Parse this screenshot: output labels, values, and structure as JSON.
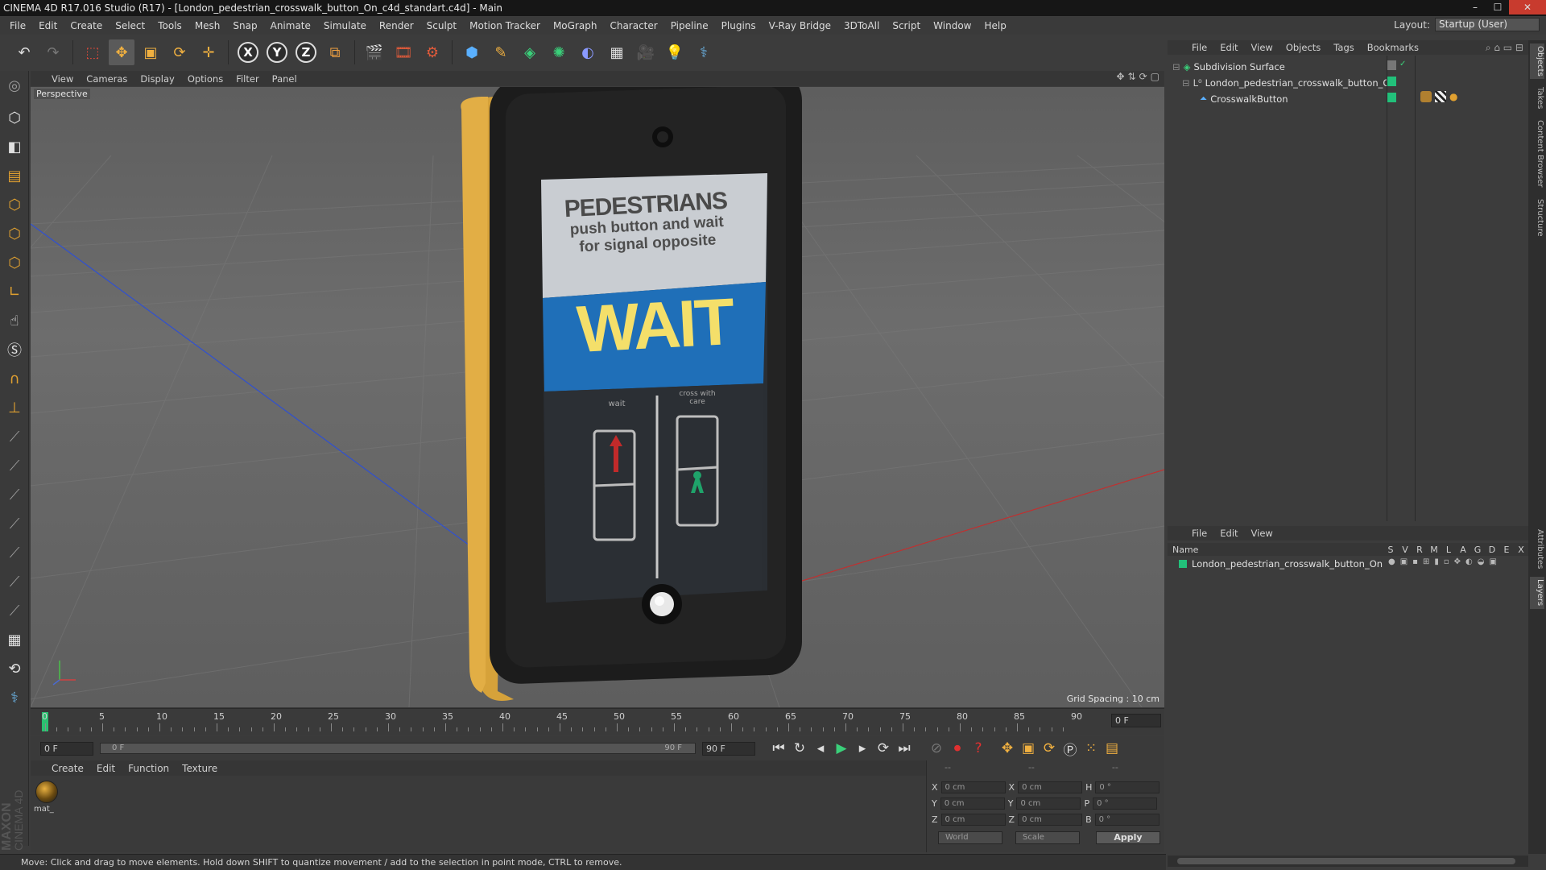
{
  "window": {
    "title": "CINEMA 4D R17.016 Studio (R17) - [London_pedestrian_crosswalk_button_On_c4d_standart.c4d] - Main",
    "minimize": "–",
    "maximize": "☐",
    "close": "✕"
  },
  "menubar": [
    "File",
    "Edit",
    "Create",
    "Select",
    "Tools",
    "Mesh",
    "Snap",
    "Animate",
    "Simulate",
    "Render",
    "Sculpt",
    "Motion Tracker",
    "MoGraph",
    "Character",
    "Pipeline",
    "Plugins",
    "V-Ray Bridge",
    "3DToAll",
    "Script",
    "Window",
    "Help"
  ],
  "layout": {
    "label": "Layout:",
    "value": "Startup (User)"
  },
  "toolbar": {
    "axes": [
      "X",
      "Y",
      "Z"
    ],
    "icons": [
      "undo-icon",
      "redo-icon",
      "live-selection-icon",
      "move-icon",
      "scale-icon",
      "rotate-icon",
      "transform-icon",
      "x-axis-icon",
      "y-axis-icon",
      "z-axis-icon",
      "coordinate-system-icon",
      "render-view-icon",
      "render-to-picture-viewer-icon",
      "edit-render-settings-icon",
      "cube-icon",
      "pen-spline-icon",
      "subdivision-surface-icon",
      "array-icon",
      "deformer-icon",
      "floor-icon",
      "camera-icon",
      "light-icon",
      "python-icon"
    ]
  },
  "viewport": {
    "menu": [
      "View",
      "Cameras",
      "Display",
      "Options",
      "Filter",
      "Panel"
    ],
    "label": "Perspective",
    "grid_spacing": "Grid Spacing : 10 cm",
    "sign": {
      "top_line1": "PEDESTRIANS",
      "top_line2": "push button and wait",
      "top_line3": "for signal opposite",
      "wait": "WAIT",
      "small_left": "wait",
      "small_right": "cross with care"
    }
  },
  "timeline": {
    "ticks": [
      "0",
      "5",
      "10",
      "15",
      "20",
      "25",
      "30",
      "35",
      "40",
      "45",
      "50",
      "55",
      "60",
      "65",
      "70",
      "75",
      "80",
      "85",
      "90"
    ],
    "current_frame": "0 F",
    "start_frame": "0 F",
    "range_start": "0 F",
    "range_end": "90 F",
    "end_frame": "90 F"
  },
  "materials": {
    "menu": [
      "Create",
      "Edit",
      "Function",
      "Texture"
    ],
    "items": [
      {
        "label": "mat_"
      }
    ]
  },
  "coordinates": {
    "header": [
      "--",
      "--",
      "--"
    ],
    "rows": [
      {
        "a": "X",
        "av": "0 cm",
        "b": "X",
        "bv": "0 cm",
        "c": "H",
        "cv": "0 °"
      },
      {
        "a": "Y",
        "av": "0 cm",
        "b": "Y",
        "bv": "0 cm",
        "c": "P",
        "cv": "0 °"
      },
      {
        "a": "Z",
        "av": "0 cm",
        "b": "Z",
        "bv": "0 cm",
        "c": "B",
        "cv": "0 °"
      }
    ],
    "mode1": "World",
    "mode2": "Scale",
    "apply": "Apply"
  },
  "status": "Move: Click and drag to move elements. Hold down SHIFT to quantize movement / add to the selection in point mode, CTRL to remove.",
  "objects_panel": {
    "menu": [
      "File",
      "Edit",
      "View",
      "Objects",
      "Tags",
      "Bookmarks"
    ],
    "items": [
      {
        "name": "Subdivision Surface",
        "indent": 0
      },
      {
        "name": "London_pedestrian_crosswalk_button_On",
        "indent": 1
      },
      {
        "name": "CrosswalkButton",
        "indent": 2
      }
    ]
  },
  "layers_panel": {
    "menu": [
      "File",
      "Edit",
      "View"
    ],
    "columns": {
      "name": "Name",
      "flags": [
        "S",
        "V",
        "R",
        "M",
        "L",
        "A",
        "G",
        "D",
        "E",
        "X"
      ]
    },
    "items": [
      {
        "name": "London_pedestrian_crosswalk_button_On"
      }
    ]
  },
  "side_tabs": [
    "Objects",
    "Takes",
    "Content Browser",
    "Structure",
    "Attributes",
    "Layers"
  ],
  "logo": {
    "line1": "MAXON",
    "line2": "CINEMA 4D"
  },
  "colors": {
    "accent_orange": "#e0a030",
    "layer_green": "#22c07a",
    "wait_yellow": "#f4df6a",
    "sign_blue": "#1f6fb8"
  }
}
